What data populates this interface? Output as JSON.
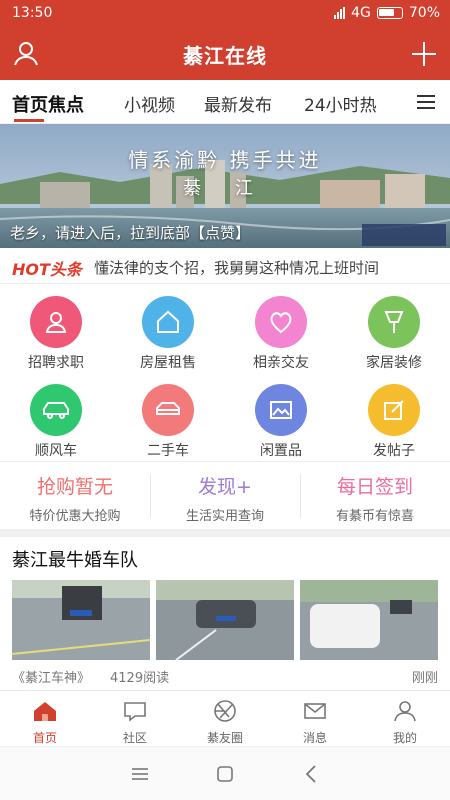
{
  "status_bar": {
    "time": "13:50",
    "network": "4G",
    "battery": "70%"
  },
  "header": {
    "title": "綦江在线",
    "left_icon": "user-icon",
    "right_icon": "plus-icon",
    "color": "#d13f2e"
  },
  "tabs": [
    {
      "label": "首页焦点",
      "active": true
    },
    {
      "label": "小视频"
    },
    {
      "label": "最新发布"
    },
    {
      "label": "24小时热"
    }
  ],
  "banner": {
    "title": "情系渝黔 携手共进",
    "subtitle": "綦 江",
    "caption": "老乡，请进入后，拉到底部【点赞】"
  },
  "hot_news": {
    "logo": "HOT头条",
    "headline": "懂法律的支个招，我舅舅这种情况上班时间"
  },
  "grid": [
    {
      "label": "招聘求职",
      "icon": "person-icon",
      "color": "#f0587a"
    },
    {
      "label": "房屋租售",
      "icon": "house-icon",
      "color": "#4fb3e8"
    },
    {
      "label": "相亲交友",
      "icon": "heart-icon",
      "color": "#f384cf"
    },
    {
      "label": "家居装修",
      "icon": "brush-icon",
      "color": "#7dc35b"
    },
    {
      "label": "顺风车",
      "icon": "car-icon",
      "color": "#2fc770"
    },
    {
      "label": "二手车",
      "icon": "used-car-icon",
      "color": "#f27a7a"
    },
    {
      "label": "闲置品",
      "icon": "image-icon",
      "color": "#6f86e0"
    },
    {
      "label": "发帖子",
      "icon": "edit-icon",
      "color": "#f5bd2d"
    }
  ],
  "promos": [
    {
      "title": "抢购暂无",
      "subtitle": "特价优惠大抢购",
      "color": "#f07070"
    },
    {
      "title": "发现+",
      "subtitle": "生活实用查询",
      "color": "#a07ad8"
    },
    {
      "title": "每日签到",
      "subtitle": "有綦币有惊喜",
      "color": "#f06aa0"
    }
  ],
  "article": {
    "title": "綦江最牛婚车队",
    "source": "《綦江车神》",
    "reads": "4129阅读",
    "time": "刚刚"
  },
  "bottom_nav": [
    {
      "label": "首页",
      "icon": "home-icon",
      "active": true
    },
    {
      "label": "社区",
      "icon": "chat-icon"
    },
    {
      "label": "綦友圈",
      "icon": "aperture-icon"
    },
    {
      "label": "消息",
      "icon": "mail-icon"
    },
    {
      "label": "我的",
      "icon": "profile-icon"
    }
  ],
  "system_nav": [
    "menu-icon",
    "square-icon",
    "back-icon"
  ]
}
